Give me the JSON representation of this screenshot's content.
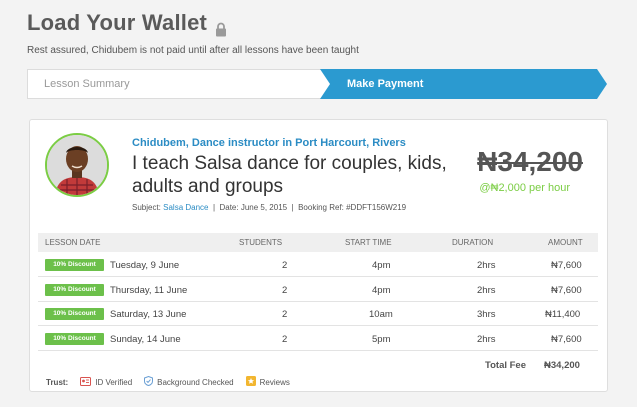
{
  "header": {
    "title": "Load Your Wallet",
    "subtitle": "Rest assured, Chidubem is not paid until after all lessons have been taught"
  },
  "stepper": {
    "steps": [
      {
        "label": "Lesson Summary",
        "active": false
      },
      {
        "label": "Make Payment",
        "active": true
      }
    ],
    "active_color": "#2b9ad0"
  },
  "tutor": {
    "name": "Chidubem, Dance instructor in Port Harcourt, Rivers",
    "lesson_title": "I teach Salsa dance for couples, kids, adults and groups",
    "subject_label": "Subject:",
    "subject": "Salsa Dance",
    "date_label": "Date: June 5, 2015",
    "booking_ref": "Booking Ref: #DDFT156W219",
    "price": "₦34,200",
    "rate": "@₦2,000 per hour"
  },
  "table": {
    "columns": [
      "LESSON DATE",
      "STUDENTS",
      "START TIME",
      "DURATION",
      "AMOUNT"
    ],
    "rows": [
      {
        "badge": "10% Discount",
        "date": "Tuesday, 9 June",
        "students": "2",
        "start": "4pm",
        "duration": "2hrs",
        "amount": "₦7,600"
      },
      {
        "badge": "10% Discount",
        "date": "Thursday, 11 June",
        "students": "2",
        "start": "4pm",
        "duration": "2hrs",
        "amount": "₦7,600"
      },
      {
        "badge": "10% Discount",
        "date": "Saturday, 13 June",
        "students": "2",
        "start": "10am",
        "duration": "3hrs",
        "amount": "₦11,400"
      },
      {
        "badge": "10% Discount",
        "date": "Sunday, 14 June",
        "students": "2",
        "start": "5pm",
        "duration": "2hrs",
        "amount": "₦7,600"
      }
    ],
    "total_label": "Total Fee",
    "total_value": "₦34,200"
  },
  "trust": {
    "label": "Trust:",
    "items": [
      {
        "icon": "id-card-icon",
        "label": "ID Verified"
      },
      {
        "icon": "shield-check-icon",
        "label": "Background Checked"
      },
      {
        "icon": "reviews-icon",
        "label": "Reviews"
      }
    ]
  },
  "colors": {
    "accent_blue": "#2b9ad0",
    "link_blue": "#2b8cc4",
    "green": "#7bcd44",
    "badge_green": "#6cc04a"
  }
}
